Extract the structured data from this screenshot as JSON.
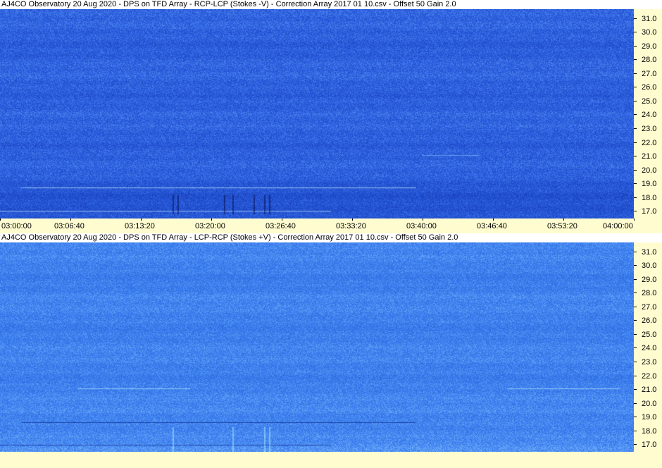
{
  "chart_data": [
    {
      "type": "heatmap",
      "title": "AJ4CO Observatory 20 Aug 2020  -  DPS on TFD Array  -  RCP-LCP (Stokes -V)  -  Correction Array 2017 01 10.csv  -  Offset 50  Gain 2.0",
      "x": [
        "03:00:00",
        "03:06:40",
        "03:13:20",
        "03:20:00",
        "03:26:40",
        "03:33:20",
        "03:40:00",
        "03:46:40",
        "03:53:20",
        "04:00:00"
      ],
      "y_ticks": [
        "31.0",
        "30.0",
        "29.0",
        "28.0",
        "27.0",
        "26.0",
        "25.0",
        "24.0",
        "23.0",
        "22.0",
        "21.0",
        "20.0",
        "19.0",
        "18.0",
        "17.0"
      ],
      "ylim": [
        16.5,
        31.7
      ],
      "colors": {
        "base": "#2a5de0",
        "dark": "#0a2a9a",
        "light": "#7fbfff"
      }
    },
    {
      "type": "heatmap",
      "title": "AJ4CO Observatory 20 Aug 2020  -  DPS on TFD Array  -  LCP-RCP (Stokes +V)  -  Correction Array 2017 01 10.csv  -  Offset 50  Gain 2.0",
      "y_ticks": [
        "31.0",
        "30.0",
        "29.0",
        "28.0",
        "27.0",
        "26.0",
        "25.0",
        "24.0",
        "23.0",
        "22.0",
        "21.0",
        "20.0",
        "19.0",
        "18.0",
        "17.0"
      ],
      "ylim": [
        16.5,
        31.7
      ],
      "colors": {
        "base": "#3a7ef0",
        "dark": "#1a4ac0",
        "light": "#9fd8ff"
      }
    }
  ]
}
